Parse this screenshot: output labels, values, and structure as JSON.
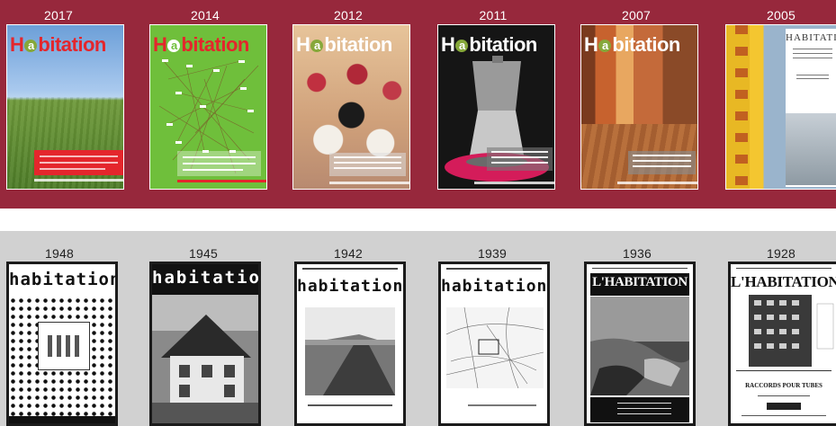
{
  "top_row": {
    "covers": [
      {
        "year": "2017",
        "title": "Habitation"
      },
      {
        "year": "2014",
        "title": "Habitation"
      },
      {
        "year": "2012",
        "title": "Habitation"
      },
      {
        "year": "2011",
        "title": "Habitation"
      },
      {
        "year": "2007",
        "title": "Habitation"
      },
      {
        "year": "2005",
        "title": "HABITATION"
      }
    ]
  },
  "bottom_row": {
    "covers": [
      {
        "year": "1948",
        "title": "habitation"
      },
      {
        "year": "1945",
        "title": "habitation"
      },
      {
        "year": "1942",
        "title": "habitation"
      },
      {
        "year": "1939",
        "title": "habitation"
      },
      {
        "year": "1936",
        "title": "L'HABITATION"
      },
      {
        "year": "1928",
        "title": "L'HABITATION"
      }
    ],
    "ad_text": "RACCORDS POUR TUBES"
  },
  "colors": {
    "top_band": "#97283c",
    "bottom_band": "#d1d1d1",
    "logo_red": "#e4262c",
    "logo_green": "#86a83a"
  }
}
